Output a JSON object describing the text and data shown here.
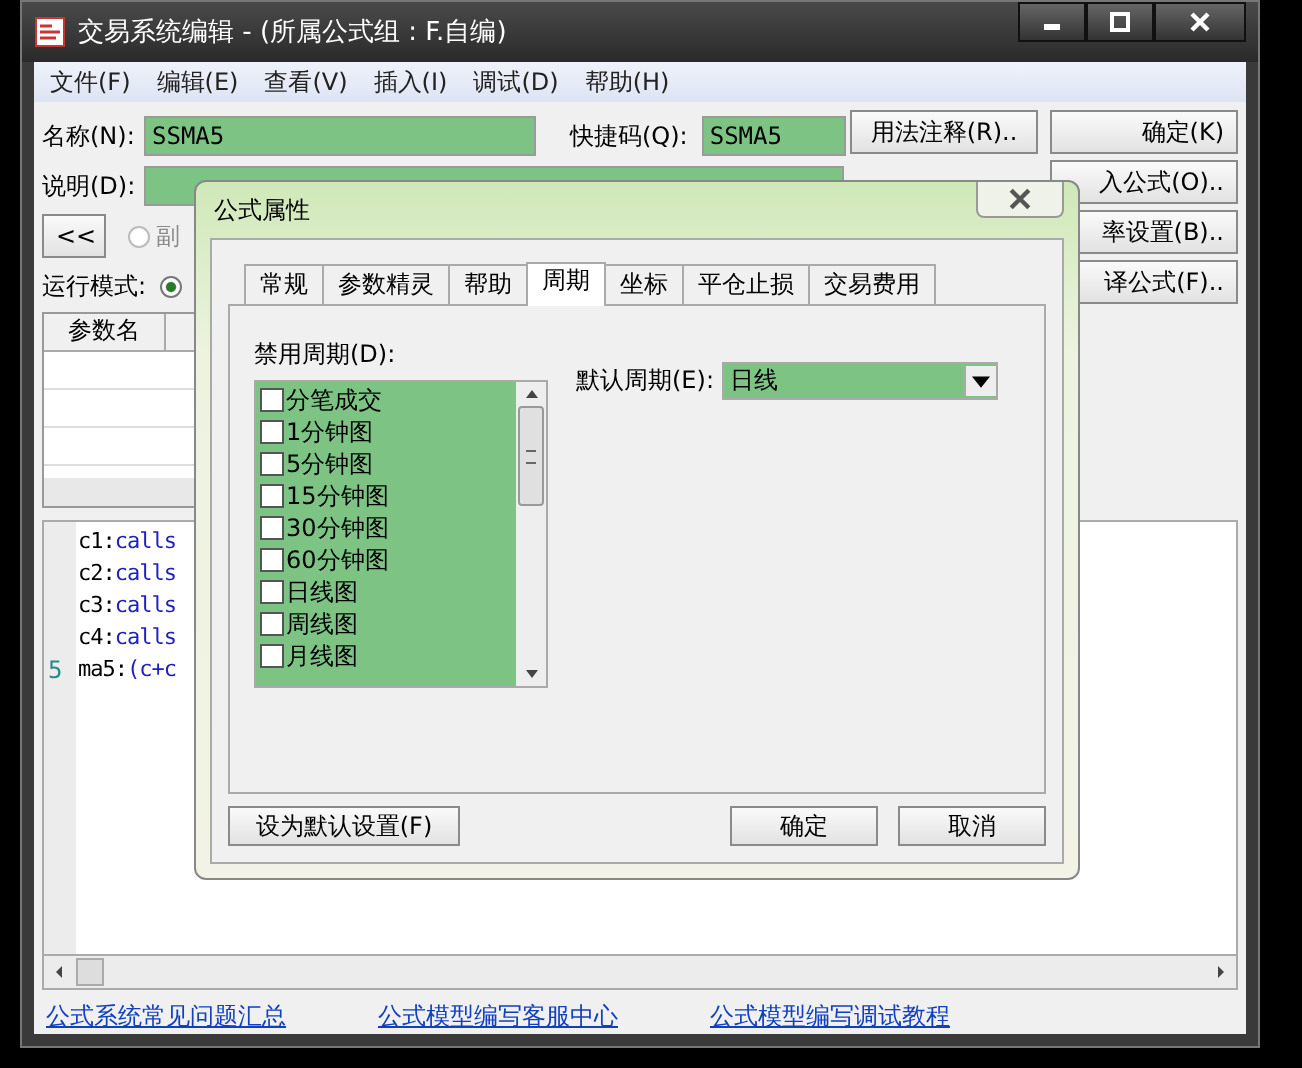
{
  "window": {
    "title": "交易系统编辑 - (所属公式组 : F.自编)"
  },
  "menu": [
    "文件(F)",
    "编辑(E)",
    "查看(V)",
    "插入(I)",
    "调试(D)",
    "帮助(H)"
  ],
  "form": {
    "name_label": "名称(N):",
    "name_value": "SSMA5",
    "shortcut_label": "快捷码(Q):",
    "shortcut_value": "SSMA5",
    "description_label": "说明(D):",
    "back_button": "<<",
    "subchart_radio": {
      "label": "副",
      "selected": false,
      "disabled": true
    },
    "run_mode_label": "运行模式:",
    "run_mode_radio": {
      "selected": true
    }
  },
  "side_buttons": [
    "用法注释(R)..",
    "确定(K)",
    "入公式(O)..",
    "率设置(B)..",
    "译公式(F).."
  ],
  "param_table": {
    "columns": [
      "参数名"
    ]
  },
  "code_lines": [
    {
      "label": "c1:",
      "expr": "calls"
    },
    {
      "label": "c2:",
      "expr": "calls"
    },
    {
      "label": "c3:",
      "expr": "calls"
    },
    {
      "label": "c4:",
      "expr": "calls"
    },
    {
      "number": "5",
      "label": "ma5:",
      "expr": "(c+c"
    }
  ],
  "links": [
    "公式系统常见问题汇总",
    "公式模型编写客服中心",
    "公式模型编写调试教程"
  ],
  "dialog": {
    "title": "公式属性",
    "tabs": [
      {
        "label": "常规",
        "selected": false
      },
      {
        "label": "参数精灵",
        "selected": false
      },
      {
        "label": "帮助",
        "selected": false
      },
      {
        "label": "周期",
        "selected": true
      },
      {
        "label": "坐标",
        "selected": false
      },
      {
        "label": "平仓止损",
        "selected": false
      },
      {
        "label": "交易费用",
        "selected": false
      }
    ],
    "disabled_periods_label": "禁用周期(D):",
    "periods": [
      {
        "label": "分笔成交",
        "checked": false
      },
      {
        "label": "1分钟图",
        "checked": false
      },
      {
        "label": "5分钟图",
        "checked": false
      },
      {
        "label": "15分钟图",
        "checked": false
      },
      {
        "label": "30分钟图",
        "checked": false
      },
      {
        "label": "60分钟图",
        "checked": false
      },
      {
        "label": "日线图",
        "checked": false
      },
      {
        "label": "周线图",
        "checked": false
      },
      {
        "label": "月线图",
        "checked": false
      }
    ],
    "default_period_label": "默认周期(E):",
    "default_period_value": "日线",
    "buttons": [
      "设为默认设置(F)",
      "确定",
      "取消"
    ]
  }
}
